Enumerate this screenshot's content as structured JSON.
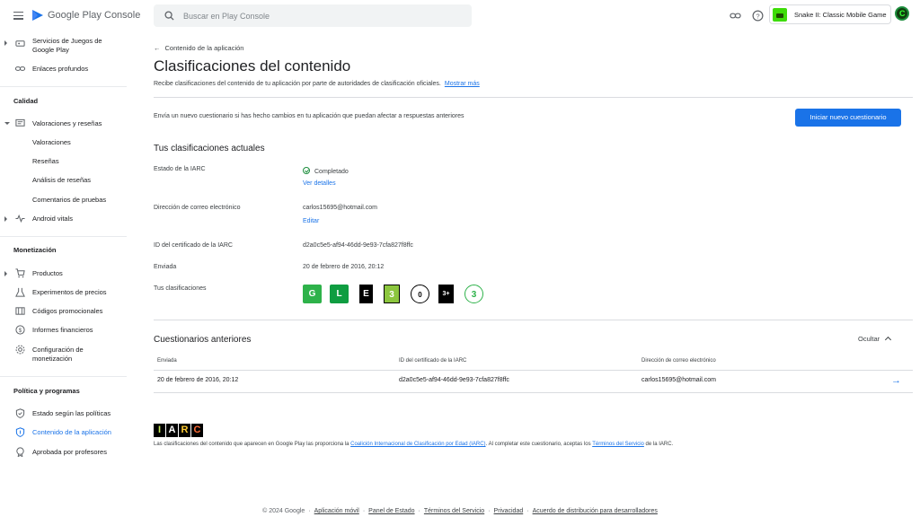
{
  "topbar": {
    "brand_prefix": "Google Play",
    "brand_suffix": "Console",
    "search_placeholder": "Buscar en Play Console",
    "app_name": "Snake II: Classic Mobile Game"
  },
  "sidebar": {
    "items_top": [
      {
        "label": "Servicios de Juegos de Google Play",
        "icon": "gamepad-icon"
      },
      {
        "label": "Enlaces profundos",
        "icon": "link-icon"
      }
    ],
    "section_quality": "Calidad",
    "ratings": {
      "label": "Valoraciones y reseñas",
      "sub": [
        "Valoraciones",
        "Reseñas",
        "Análisis de reseñas",
        "Comentarios de pruebas"
      ]
    },
    "android_vitals": "Android vitals",
    "section_monetization": "Monetización",
    "monetization": [
      {
        "label": "Productos",
        "icon": "cart-icon"
      },
      {
        "label": "Experimentos de precios",
        "icon": "flask-icon"
      },
      {
        "label": "Códigos promocionales",
        "icon": "promo-icon"
      },
      {
        "label": "Informes financieros",
        "icon": "dollar-icon"
      },
      {
        "label": "Configuración de monetización",
        "icon": "gear-icon"
      }
    ],
    "section_policy": "Política y programas",
    "policy": [
      {
        "label": "Estado según las políticas",
        "icon": "shield-check-icon"
      },
      {
        "label": "Contenido de la aplicación",
        "icon": "shield-icon"
      },
      {
        "label": "Aprobada por profesores",
        "icon": "badge-icon"
      }
    ]
  },
  "main": {
    "back_link": "Contenido de la aplicación",
    "title": "Clasificaciones del contenido",
    "description": "Recibe clasificaciones del contenido de tu aplicación por parte de autoridades de clasificación oficiales.",
    "learn_more": "Mostrar más",
    "notice": "Envía un nuevo cuestionario si has hecho cambios en tu aplicación que puedan afectar a respuestas anteriores",
    "start_button": "Iniciar nuevo cuestionario",
    "current_title": "Tus clasificaciones actuales",
    "iarc_status_label": "Estado de la IARC",
    "iarc_status_value": "Completado",
    "view_details": "Ver detalles",
    "email_label": "Dirección de correo electrónico",
    "email_value": "carlos15695@hotmail.com",
    "edit": "Editar",
    "cert_label": "ID del certificado de la IARC",
    "cert_value": "d2a0c5e5-af94-46dd-9e93-7cfa827f8ffc",
    "sent_label": "Enviada",
    "sent_value": "20 de febrero de 2016, 20:12",
    "ratings_label": "Tus clasificaciones",
    "badges": [
      "G",
      "L",
      "E",
      "3",
      "0",
      "3+",
      "3"
    ],
    "previous_title": "Cuestionarios anteriores",
    "hide": "Ocultar",
    "table_headers": [
      "Enviada",
      "ID del certificado de la IARC",
      "Dirección de correo electrónico"
    ],
    "table_row": [
      "20 de febrero de 2016, 20:12",
      "d2a0c5e5-af94-46dd-9e93-7cfa827f8ffc",
      "carlos15695@hotmail.com"
    ],
    "iarc_letters": [
      "I",
      "A",
      "R",
      "C"
    ],
    "footnote_pre": "Las clasificaciones del contenido que aparecen en Google Play las proporciona la ",
    "footnote_link1": "Coalición Internacional de Clasificación por Edad (IARC)",
    "footnote_mid": ". Al completar este cuestionario, aceptas los ",
    "footnote_link2": "Términos del Servicio",
    "footnote_post": " de la IARC."
  },
  "footer": {
    "copyright": "© 2024 Google",
    "links": [
      "Aplicación móvil",
      "Panel de Estado",
      "Términos del Servicio",
      "Privacidad",
      "Acuerdo de distribución para desarrolladores"
    ]
  }
}
